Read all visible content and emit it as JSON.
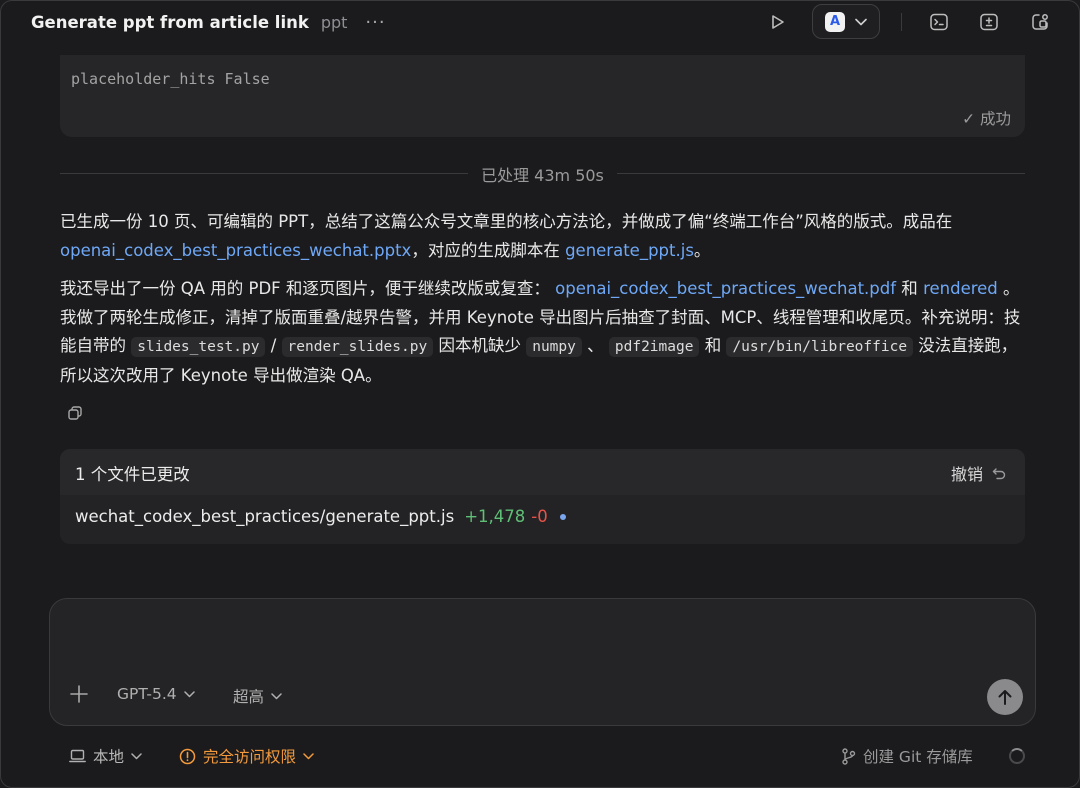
{
  "header": {
    "title": "Generate ppt from article link",
    "subtitle": "ppt",
    "more_label": "···"
  },
  "output": {
    "text": "placeholder_hits False",
    "status": "✓ 成功"
  },
  "processed": {
    "label": "已处理 43m 50s"
  },
  "message": {
    "p1_a": "已生成一份 10 页、可编辑的 PPT，总结了这篇公众号文章里的核心方法论，并做成了偏“终端工作台”风格的版式。成品在 ",
    "p1_link1": "openai_codex_best_practices_wechat.pptx",
    "p1_b": "，对应的生成脚本在 ",
    "p1_link2": "generate_ppt.js",
    "p1_c": "。",
    "p2_a": "我还导出了一份 QA 用的 PDF 和逐页图片，便于继续改版或复查： ",
    "p2_link1": "openai_codex_best_practices_wechat.pdf",
    "p2_b": " 和 ",
    "p2_link2": "rendered",
    "p2_c": " 。我做了两轮生成修正，清掉了版面重叠/越界告警，并用 Keynote 导出图片后抽查了封面、MCP、线程管理和收尾页。补充说明：技能自带的 ",
    "code1": "slides_test.py",
    "p2_d": " / ",
    "code2": "render_slides.py",
    "p2_e": " 因本机缺少 ",
    "code3": "numpy",
    "p2_f": " 、 ",
    "code4": "pdf2image",
    "p2_g": " 和 ",
    "code5": "/usr/bin/libreoffice",
    "p2_h": " 没法直接跑，所以这次改用了 Keynote 导出做渲染 QA。"
  },
  "changes": {
    "title": "1 个文件已更改",
    "undo_label": "撤销",
    "file": {
      "name": "wechat_codex_best_practices/generate_ppt.js",
      "added": "+1,478",
      "removed": "-0"
    }
  },
  "composer": {
    "model": "GPT-5.4",
    "effort": "超高"
  },
  "bottom": {
    "local_label": "本地",
    "access_label": "完全访问权限",
    "git_label": "创建 Git 存储库"
  },
  "colors": {
    "link": "#6ea8f7",
    "added": "#5fbf76",
    "removed": "#e5534b",
    "warning": "#f29a3d"
  }
}
